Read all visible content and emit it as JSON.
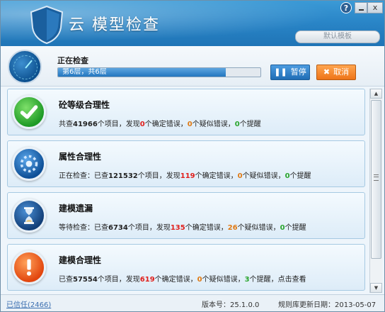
{
  "window": {
    "title": "云 模型检查",
    "help": "?",
    "close": "x",
    "template_select": "默认模板"
  },
  "progress": {
    "label": "正在检查",
    "status_text": "第6层，共6层",
    "fraction": 0.83,
    "pause_label": "暂停",
    "pause_icon": "❚❚",
    "cancel_label": "取消",
    "cancel_icon": "✖"
  },
  "items": [
    {
      "name": "砼等级合理性",
      "icon": "check-icon",
      "segments": [
        {
          "t": "共查",
          "c": ""
        },
        {
          "t": "41966",
          "c": "b"
        },
        {
          "t": "个项目，发现",
          "c": ""
        },
        {
          "t": "0",
          "c": "r"
        },
        {
          "t": "个确定错误，",
          "c": ""
        },
        {
          "t": "0",
          "c": "o"
        },
        {
          "t": "个疑似错误，",
          "c": ""
        },
        {
          "t": "0",
          "c": "g"
        },
        {
          "t": "个提醒",
          "c": ""
        }
      ]
    },
    {
      "name": "属性合理性",
      "icon": "loading-icon",
      "segments": [
        {
          "t": "正在检查：已查",
          "c": ""
        },
        {
          "t": "121532",
          "c": "b"
        },
        {
          "t": "个项目，发现",
          "c": ""
        },
        {
          "t": "119",
          "c": "r"
        },
        {
          "t": "个确定错误，",
          "c": ""
        },
        {
          "t": "0",
          "c": "o"
        },
        {
          "t": "个疑似错误，",
          "c": ""
        },
        {
          "t": "0",
          "c": "g"
        },
        {
          "t": "个提醒",
          "c": ""
        }
      ]
    },
    {
      "name": "建模遗漏",
      "icon": "hourglass-icon",
      "segments": [
        {
          "t": "等待检查：已查",
          "c": ""
        },
        {
          "t": "6734",
          "c": "b"
        },
        {
          "t": "个项目，发现",
          "c": ""
        },
        {
          "t": "135",
          "c": "r"
        },
        {
          "t": "个确定错误，",
          "c": ""
        },
        {
          "t": "26",
          "c": "o"
        },
        {
          "t": "个疑似错误，",
          "c": ""
        },
        {
          "t": "0",
          "c": "g"
        },
        {
          "t": "个提醒",
          "c": ""
        }
      ]
    },
    {
      "name": "建模合理性",
      "icon": "warning-icon",
      "segments": [
        {
          "t": "已查",
          "c": ""
        },
        {
          "t": "57554",
          "c": "b"
        },
        {
          "t": "个项目，发现",
          "c": ""
        },
        {
          "t": "619",
          "c": "r"
        },
        {
          "t": "个确定错误，",
          "c": ""
        },
        {
          "t": "0",
          "c": "o"
        },
        {
          "t": "个疑似错误，",
          "c": ""
        },
        {
          "t": "3",
          "c": "g"
        },
        {
          "t": "个提醒，点击查看",
          "c": ""
        }
      ]
    }
  ],
  "statusbar": {
    "trusted": "已信任(2466)",
    "version": "版本号：25.1.0.0",
    "rule_date": "规则库更新日期：2013-05-07"
  },
  "colors": {
    "error": "#e0201c",
    "suspect": "#e07a14",
    "reminder": "#2aa52e"
  }
}
